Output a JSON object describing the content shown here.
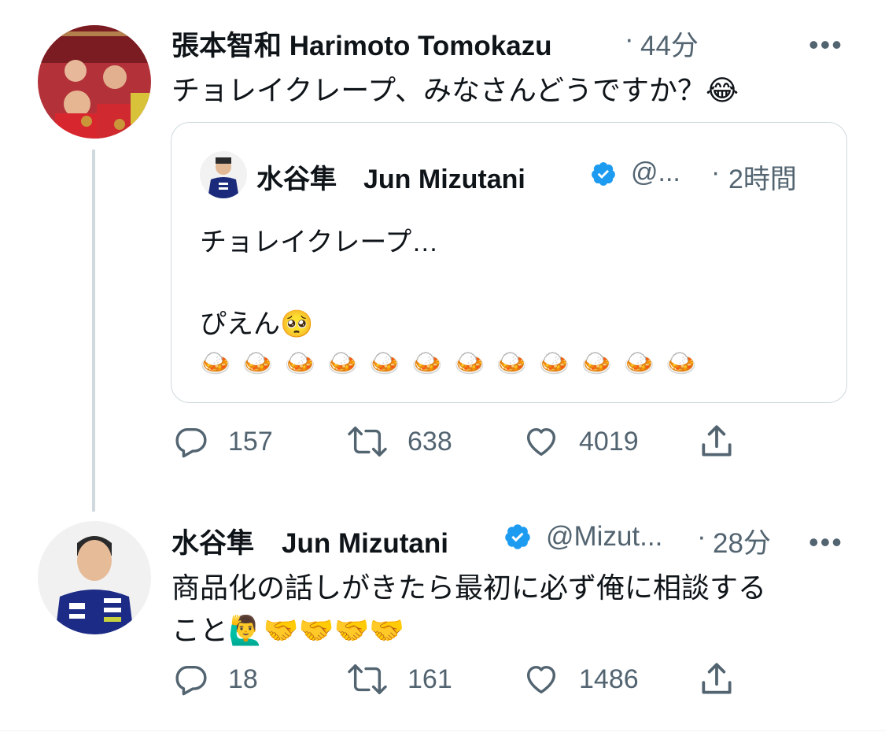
{
  "tweet1": {
    "author": "張本智和 Harimoto Tomokazu",
    "sep": "·",
    "time": "44分",
    "more": "•••",
    "text": "チョレイクレープ、みなさんどうですか？😂",
    "quote": {
      "author": "水谷隼　Jun Mizutani",
      "handle": "@...",
      "sep": "·",
      "time": "2時間",
      "line1": "チョレイクレープ…",
      "line2": "ぴえん🥺",
      "emoji_row": "🍛🍛🍛🍛🍛🍛🍛🍛🍛🍛🍛🍛"
    },
    "replies": "157",
    "retweets": "638",
    "likes": "4019"
  },
  "tweet2": {
    "author": "水谷隼　Jun Mizutani",
    "handle": "@Mizut...",
    "sep": "·",
    "time": "28分",
    "more": "•••",
    "text_line1": "商品化の話しがきたら最初に必ず俺に相談する",
    "text_line2": "こと🙋‍♂️🤝🤝🤝🤝",
    "replies": "18",
    "retweets": "161",
    "likes": "1486"
  },
  "colors": {
    "text": "#0f1419",
    "secondary": "#536471",
    "verified": "#1d9bf0",
    "thread_line": "#cfd9de"
  },
  "icons": [
    "reply-icon",
    "retweet-icon",
    "like-icon",
    "share-icon",
    "verified-badge-icon",
    "more-icon"
  ]
}
